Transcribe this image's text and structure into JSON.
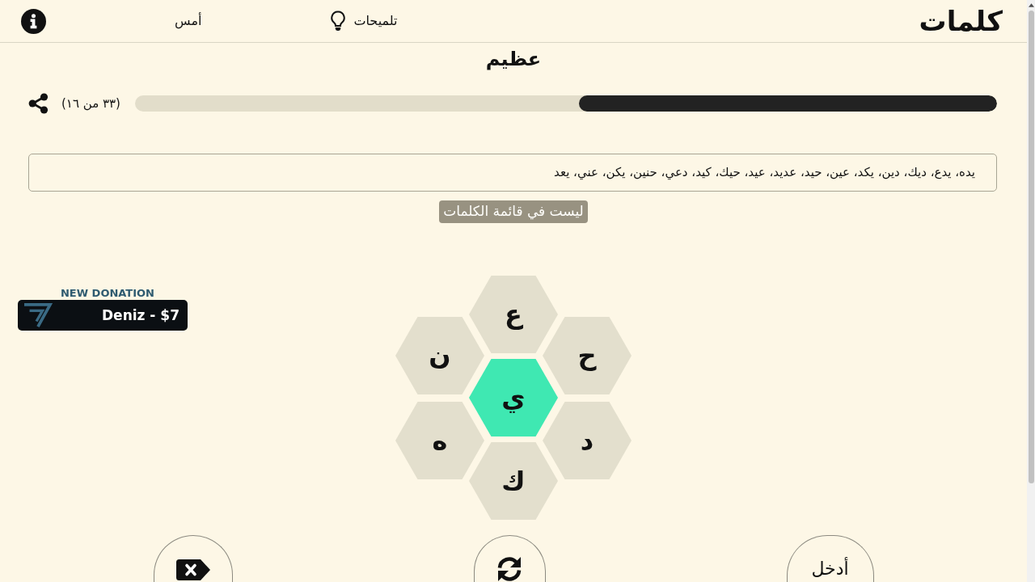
{
  "header": {
    "logo": "كلمات",
    "hints_label": "تلميحات",
    "yesterday_label": "أمس"
  },
  "rank": "عظيم",
  "progress": {
    "label": "(٣٣ من ١٦)",
    "level": 0.485
  },
  "found_words": "يده، يدع، ديك، دين، يكد، عين، حيد، عديد، عيد، حيك، كيد، دعي، حنين، يكن، عني، يعد",
  "message": {
    "text": "ليست في قائمة الكلمات",
    "fading": true
  },
  "donation_alert": {
    "title": "NEW DONATION",
    "text": "Deniz - $7"
  },
  "letters": {
    "center": "ي",
    "outer": [
      "ع",
      "ح",
      "د",
      "ك",
      "ه",
      "ن"
    ]
  },
  "actions": [
    {
      "kind": "delete"
    },
    {
      "kind": "shuffle"
    },
    {
      "kind": "enter",
      "label": "أدخل"
    }
  ]
}
